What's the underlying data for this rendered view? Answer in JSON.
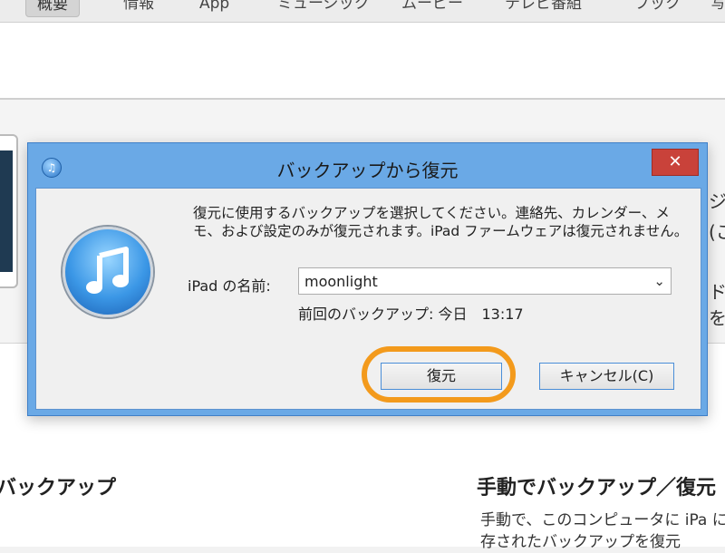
{
  "tabs": [
    "概要",
    "情報",
    "App",
    "ミュージック",
    "ムービー",
    "テレビ番組",
    "ブック",
    "写"
  ],
  "background": {
    "right_edge_texts": [
      "ジ",
      "(こ",
      "ドを"
    ],
    "backup_heading": "バックアップ",
    "manual_heading": "手動でバックアップ／復元",
    "manual_text": "手動で、このコンピュータに iPa に保存されたバックアップを復元"
  },
  "dialog": {
    "title": "バックアップから復元",
    "close_label": "✕",
    "message": "復元に使用するバックアップを選択してください。連絡先、カレンダー、メモ、および設定のみが復元されます。iPad ファームウェアは復元されません。",
    "name_label": "iPad の名前:",
    "name_value": "moonlight",
    "last_backup": "前回のバックアップ: 今日　13:17",
    "restore_button": "復元",
    "cancel_button": "キャンセル(C)"
  },
  "colors": {
    "dialog_frame": "#6aa9e6",
    "close_button": "#c9423a",
    "highlight_ring": "#f39a1c"
  },
  "icons": [
    "itunes-app-icon",
    "close-icon",
    "chevron-down-icon",
    "itunes-logo-icon"
  ]
}
